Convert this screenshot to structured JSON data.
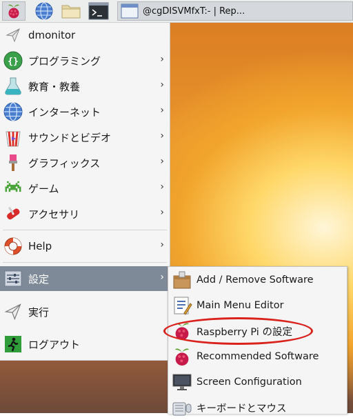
{
  "taskbar": {
    "menu_icon": "raspberry-icon",
    "launchers": [
      {
        "name": "web-browser",
        "icon": "globe-icon"
      },
      {
        "name": "file-manager",
        "icon": "folder-icon"
      },
      {
        "name": "terminal",
        "icon": "terminal-icon"
      }
    ],
    "task_title": "@cgDISVMfxT:- | Rep..."
  },
  "main_menu": {
    "items": [
      {
        "label": "dmonitor",
        "icon": "paper-plane-icon",
        "has_submenu": false
      },
      {
        "label": "プログラミング",
        "icon": "code-braces-icon",
        "has_submenu": true
      },
      {
        "label": "教育・教養",
        "icon": "flask-icon",
        "has_submenu": true
      },
      {
        "label": "インターネット",
        "icon": "globe-icon",
        "has_submenu": true
      },
      {
        "label": "サウンドとビデオ",
        "icon": "popcorn-icon",
        "has_submenu": true
      },
      {
        "label": "グラフィックス",
        "icon": "paintbrush-icon",
        "has_submenu": true
      },
      {
        "label": "ゲーム",
        "icon": "space-invader-icon",
        "has_submenu": true
      },
      {
        "label": "アクセサリ",
        "icon": "swiss-knife-icon",
        "has_submenu": true
      },
      {
        "label": "Help",
        "icon": "lifebuoy-icon",
        "has_submenu": true
      },
      {
        "label": "設定",
        "icon": "settings-sliders-icon",
        "has_submenu": true,
        "selected": true
      },
      {
        "label": "実行",
        "icon": "paper-plane-icon",
        "has_submenu": false
      },
      {
        "label": "ログアウト",
        "icon": "exit-icon",
        "has_submenu": false
      }
    ],
    "arrow_glyph": "›"
  },
  "settings_submenu": {
    "items": [
      {
        "label": "Add / Remove Software",
        "icon": "package-icon"
      },
      {
        "label": "Main Menu Editor",
        "icon": "menu-editor-icon"
      },
      {
        "label": "Raspberry Pi の設定",
        "icon": "raspberry-icon",
        "highlighted": true
      },
      {
        "label": "Recommended Software",
        "icon": "raspberry-icon"
      },
      {
        "label": "Screen Configuration",
        "icon": "monitor-icon"
      },
      {
        "label": "キーボードとマウス",
        "icon": "keyboard-mouse-icon"
      }
    ]
  },
  "colors": {
    "selected_row": "#7f8a99",
    "highlight_ellipse": "#d9221c",
    "menu_bg": "#f5f5f5",
    "raspberry_red": "#c51a4a",
    "raspberry_leaf": "#5aa02c"
  }
}
